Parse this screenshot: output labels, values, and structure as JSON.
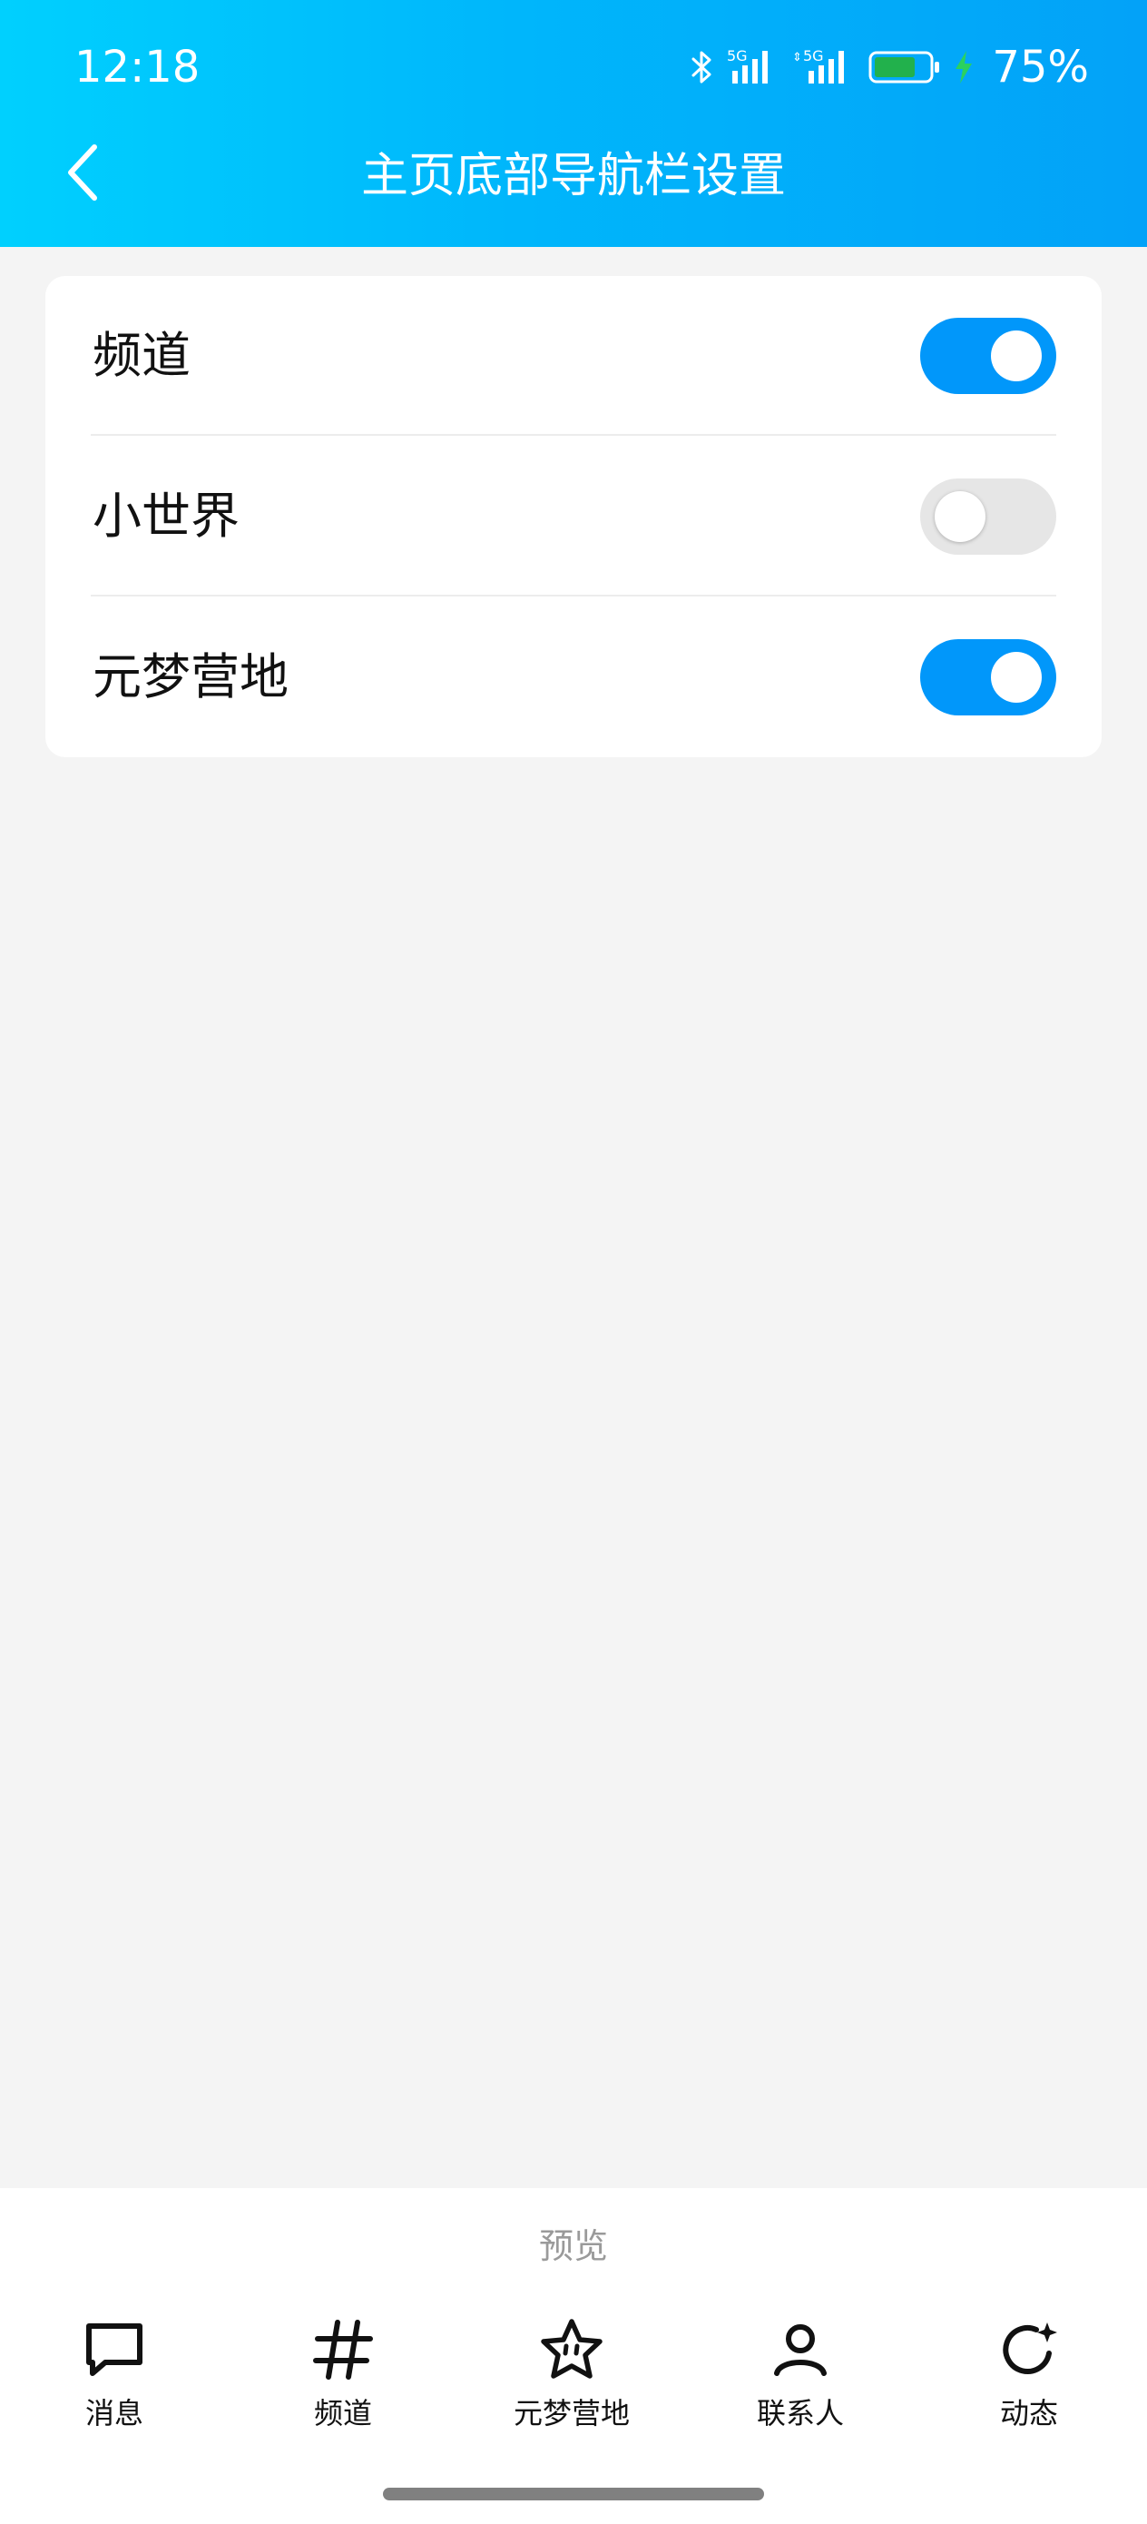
{
  "status_bar": {
    "time": "12:18",
    "signal1_label": "5G",
    "signal2_label": "5G",
    "battery_percent": "75%",
    "battery_level": 0.75,
    "icons": [
      "bluetooth-icon",
      "signal-5g-icon",
      "signal-5g-icon",
      "battery-icon",
      "charging-bolt-icon"
    ]
  },
  "header": {
    "title": "主页底部导航栏设置",
    "back_icon": "chevron-left-icon"
  },
  "settings": {
    "items": [
      {
        "label": "频道",
        "enabled": true
      },
      {
        "label": "小世界",
        "enabled": false
      },
      {
        "label": "元梦营地",
        "enabled": true
      }
    ]
  },
  "preview": {
    "label": "预览",
    "tabs": [
      {
        "label": "消息",
        "icon": "message-bubble-icon"
      },
      {
        "label": "频道",
        "icon": "hashtag-icon"
      },
      {
        "label": "元梦营地",
        "icon": "star-icon"
      },
      {
        "label": "联系人",
        "icon": "person-icon"
      },
      {
        "label": "动态",
        "icon": "refresh-star-icon"
      }
    ]
  },
  "colors": {
    "header_gradient_start": "#00d0fe",
    "header_gradient_end": "#03a2f8",
    "toggle_on": "#0197fa",
    "toggle_off": "#e6e6e6",
    "battery_fill": "#22b14c",
    "bolt": "#2bd15f",
    "background": "#f4f4f4"
  }
}
